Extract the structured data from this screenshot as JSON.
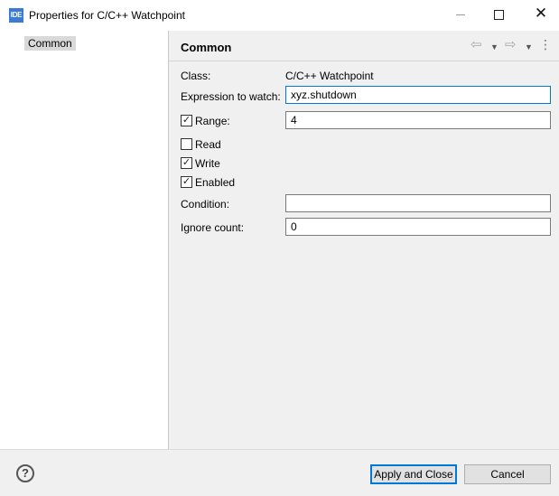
{
  "window": {
    "icon_text": "IDE",
    "title": "Properties for C/C++ Watchpoint",
    "controls": {
      "minimize": "—",
      "maximize": "",
      "close": "✕"
    }
  },
  "sidebar": {
    "items": [
      {
        "label": "Common",
        "selected": true
      }
    ]
  },
  "page": {
    "title": "Common",
    "nav": {
      "back_icon": "⇦",
      "dropdown_icon": "▼",
      "forward_icon": "⇨",
      "menu_icon": "⋮"
    }
  },
  "form": {
    "class": {
      "label": "Class:",
      "value": "C/C++ Watchpoint"
    },
    "expression": {
      "label": "Expression to watch:",
      "value": "xyz.shutdown"
    },
    "range": {
      "label": "Range:",
      "checked": true,
      "value": "4"
    },
    "read": {
      "label": "Read",
      "checked": false
    },
    "write": {
      "label": "Write",
      "checked": true
    },
    "enabled": {
      "label": "Enabled",
      "checked": true
    },
    "condition": {
      "label": "Condition:",
      "value": ""
    },
    "ignore_count": {
      "label": "Ignore count:",
      "value": "0"
    },
    "check_mark": "✓"
  },
  "buttons": {
    "help": "?",
    "apply_close": "Apply and Close",
    "cancel": "Cancel"
  },
  "colors": {
    "accent": "#0078d7",
    "selection_bg": "#d9d9d9",
    "dialog_bg": "#f0f0f0"
  }
}
